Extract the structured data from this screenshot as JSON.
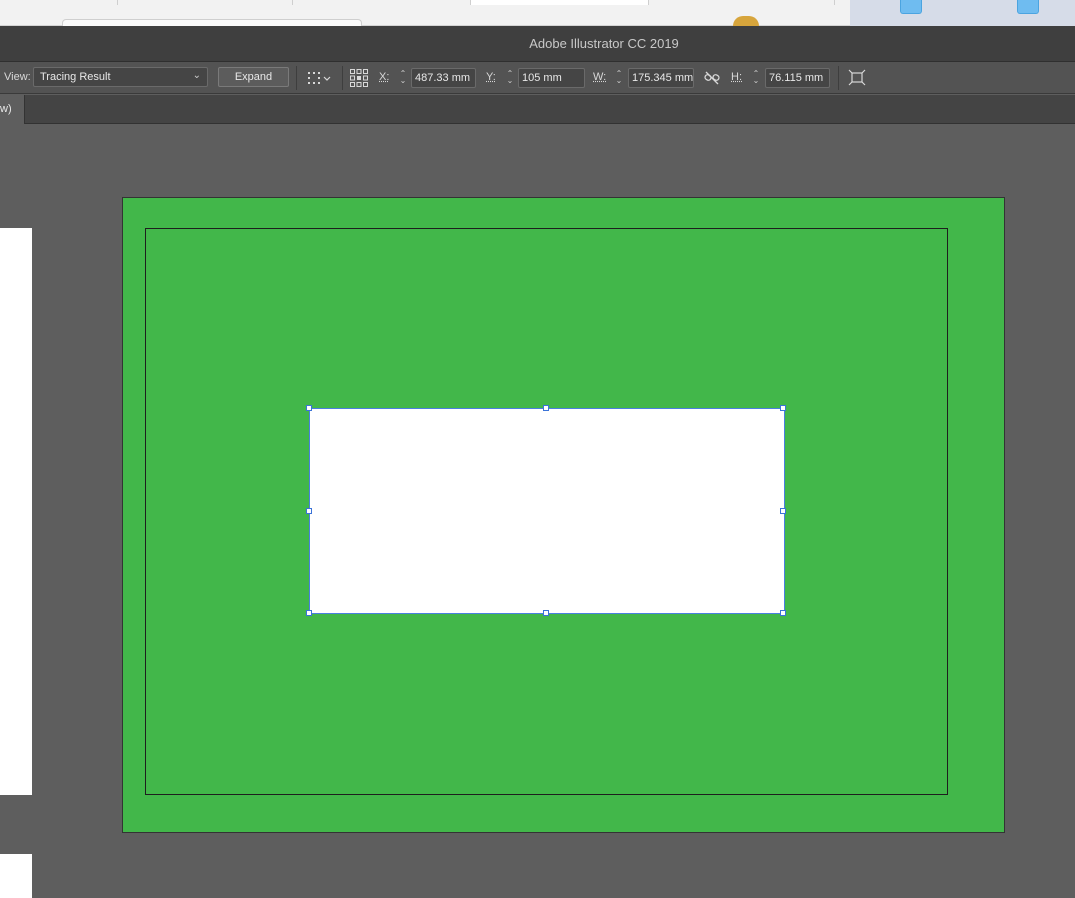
{
  "window": {
    "title": "Adobe Illustrator CC 2019"
  },
  "control_bar": {
    "view_label": "View:",
    "view_value": "Tracing Result",
    "expand_label": "Expand",
    "x_label": "X:",
    "x_value": "487.33 mm",
    "y_label": "Y:",
    "y_value": "105 mm",
    "w_label": "W:",
    "w_value": "175.345 mm",
    "h_label": "H:",
    "h_value": "76.115 mm"
  },
  "document_tab": {
    "label": "w)"
  },
  "colors": {
    "artboard_fill": "#42b74a",
    "canvas_bg": "#5e5e5e",
    "selection": "#3b73d8"
  }
}
